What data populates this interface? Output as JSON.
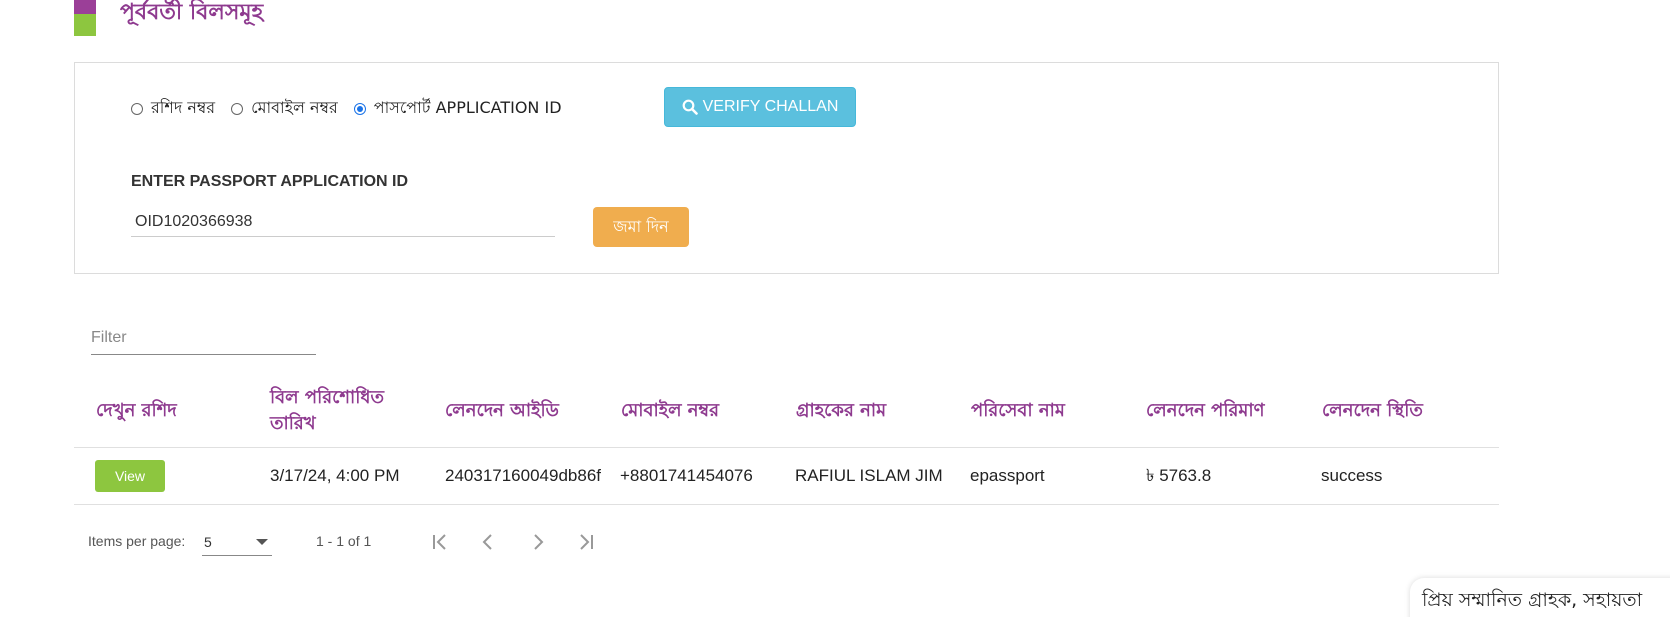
{
  "header": {
    "title": "পূর্ববর্তী বিলসমূহ"
  },
  "search": {
    "radio_options": [
      {
        "label": "রশিদ নম্বর",
        "selected": false
      },
      {
        "label": "মোবাইল নম্বর",
        "selected": false
      },
      {
        "label": "পাসপোর্ট APPLICATION ID",
        "selected": true
      }
    ],
    "verify_label": "VERIFY CHALLAN",
    "field_label": "ENTER PASSPORT APPLICATION ID",
    "input_value": "OID1020366938",
    "submit_label": "জমা দিন"
  },
  "filter": {
    "placeholder": "Filter"
  },
  "table": {
    "columns": [
      "দেখুন রশিদ",
      "বিল পরিশোধিত তারিখ",
      "লেনদেন আইডি",
      "মোবাইল নম্বর",
      "গ্রাহকের নাম",
      "পরিসেবা নাম",
      "লেনদেন পরিমাণ",
      "লেনদেন স্থিতি"
    ],
    "rows": [
      {
        "view_label": "View",
        "date": "3/17/24, 4:00 PM",
        "transaction_id": "240317160049db86f",
        "mobile": "+8801741454076",
        "customer_name": "RAFIUL ISLAM JIM",
        "service_name": "epassport",
        "amount": "৳ 5763.8",
        "status": "success"
      }
    ]
  },
  "paginator": {
    "items_per_page_label": "Items per page:",
    "page_size": "5",
    "range_label": "1 - 1 of 1"
  },
  "toast": {
    "text": "প্রিয় সম্মানিত গ্রাহক, সহায়তা"
  },
  "colors": {
    "brand_purple": "#8e3a8f",
    "brand_green": "#8dc63f",
    "verify_blue": "#5bc0de",
    "submit_orange": "#f0ad4e",
    "radio_blue": "#1a73e8"
  }
}
